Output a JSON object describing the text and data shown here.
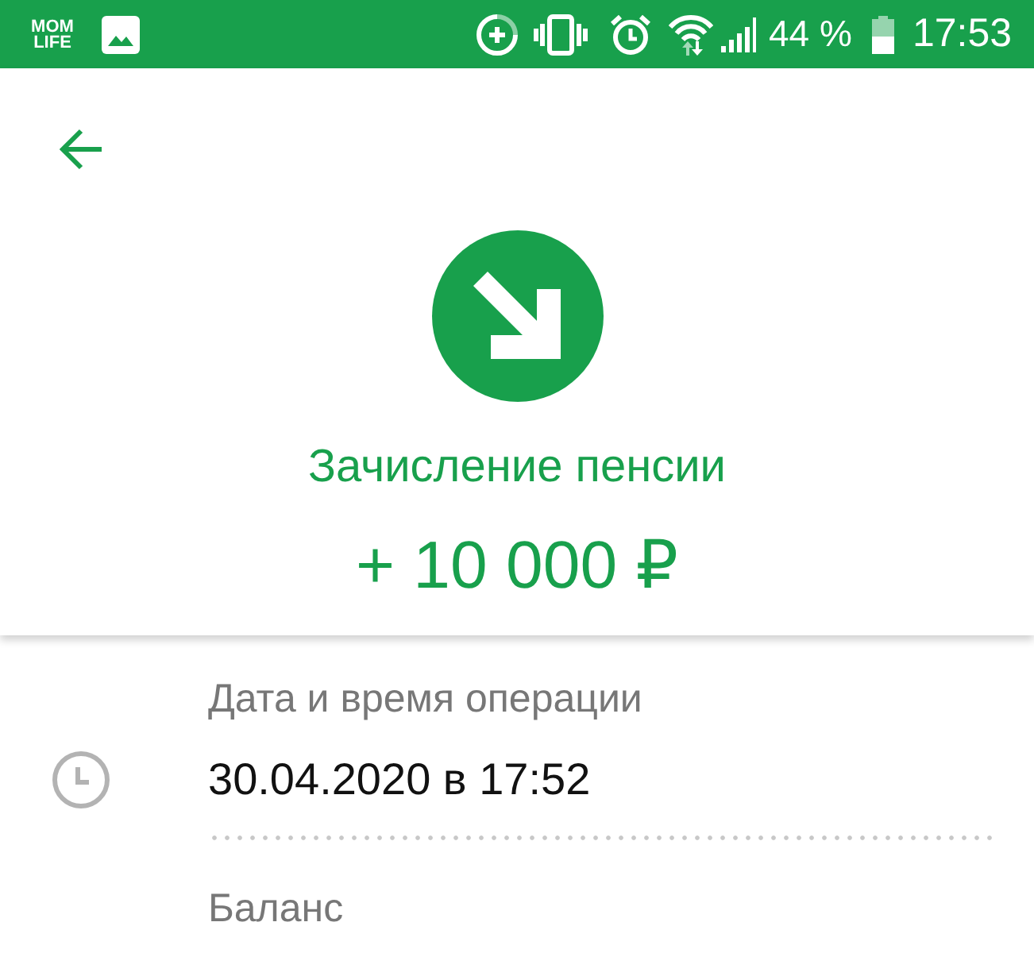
{
  "status_bar": {
    "logo": "MOM LIFE",
    "battery_percent": "44 %",
    "time": "17:53"
  },
  "header": {
    "title": "Зачисление пенсии",
    "amount": "+ 10 000 ₽"
  },
  "details": [
    {
      "kind": "datetime",
      "label": "Дата и время операции",
      "value": "30.04.2020 в 17:52"
    },
    {
      "kind": "plain",
      "label": "Баланс"
    }
  ]
}
